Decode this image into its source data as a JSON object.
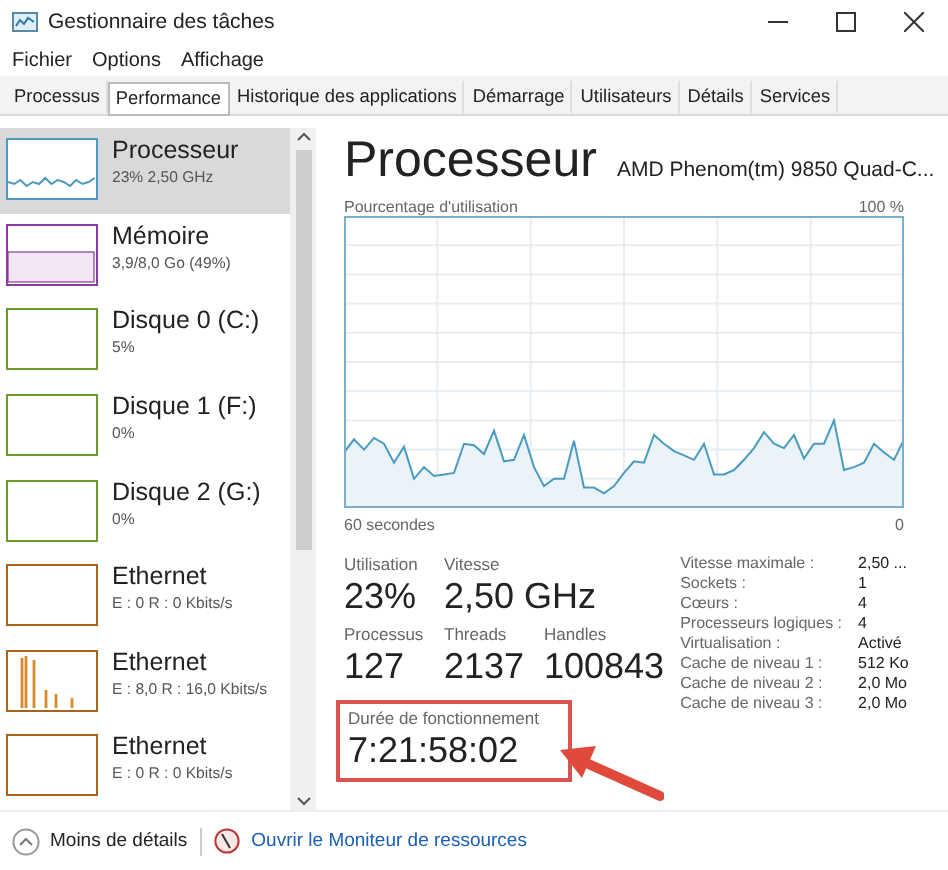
{
  "window": {
    "title": "Gestionnaire des tâches"
  },
  "menu": [
    "Fichier",
    "Options",
    "Affichage"
  ],
  "tabs": [
    {
      "label": "Processus",
      "selected": false
    },
    {
      "label": "Performance",
      "selected": true
    },
    {
      "label": "Historique des applications",
      "selected": false
    },
    {
      "label": "Démarrage",
      "selected": false
    },
    {
      "label": "Utilisateurs",
      "selected": false
    },
    {
      "label": "Détails",
      "selected": false
    },
    {
      "label": "Services",
      "selected": false
    }
  ],
  "sidebar": {
    "items": [
      {
        "kind": "cpu",
        "name": "Processeur",
        "detail": "23% 2,50 GHz",
        "selected": true
      },
      {
        "kind": "memory",
        "name": "Mémoire",
        "detail": "3,9/8,0 Go (49%)",
        "selected": false
      },
      {
        "kind": "disk",
        "name": "Disque 0 (C:)",
        "detail": "5%",
        "selected": false
      },
      {
        "kind": "disk",
        "name": "Disque 1 (F:)",
        "detail": "0%",
        "selected": false
      },
      {
        "kind": "disk",
        "name": "Disque 2 (G:)",
        "detail": "0%",
        "selected": false
      },
      {
        "kind": "ethernet",
        "name": "Ethernet",
        "detail": "E : 0 R : 0 Kbits/s",
        "selected": false,
        "active": false
      },
      {
        "kind": "ethernet",
        "name": "Ethernet",
        "detail": "E : 8,0 R : 16,0 Kbits/s",
        "selected": false,
        "active": true
      },
      {
        "kind": "ethernet",
        "name": "Ethernet",
        "detail": "E : 0 R : 0 Kbits/s",
        "selected": false,
        "active": false
      }
    ]
  },
  "main": {
    "title": "Processeur",
    "subtitle": "AMD Phenom(tm) 9850 Quad-C...",
    "graph": {
      "title": "Pourcentage d'utilisation",
      "top_label": "100 %",
      "start_label": "60 secondes",
      "end_label": "0"
    },
    "stats_row_1": [
      {
        "label": "Utilisation",
        "value": "23%"
      },
      {
        "label": "Vitesse",
        "value": "2,50 GHz"
      }
    ],
    "stats_row_2": [
      {
        "label": "Processus",
        "value": "127"
      },
      {
        "label": "Threads",
        "value": "2137"
      },
      {
        "label": "Handles",
        "value": "100843"
      }
    ],
    "uptime": {
      "label": "Durée de fonctionnement",
      "value": "7:21:58:02",
      "highlighted": true
    },
    "details": [
      {
        "label": "Vitesse maximale :",
        "value": "2,50 ..."
      },
      {
        "label": "Sockets :",
        "value": "1"
      },
      {
        "label": "Cœurs :",
        "value": "4"
      },
      {
        "label": "Processeurs logiques :",
        "value": "4"
      },
      {
        "label": "Virtualisation :",
        "value": "Activé"
      },
      {
        "label": "Cache de niveau 1 :",
        "value": "512 Ko"
      },
      {
        "label": "Cache de niveau 2 :",
        "value": "2,0 Mo"
      },
      {
        "label": "Cache de niveau 3 :",
        "value": "2,0 Mo"
      }
    ]
  },
  "footer": {
    "less_details": "Moins de détails",
    "monitor_link": "Ouvrir le Moniteur de ressources"
  }
}
